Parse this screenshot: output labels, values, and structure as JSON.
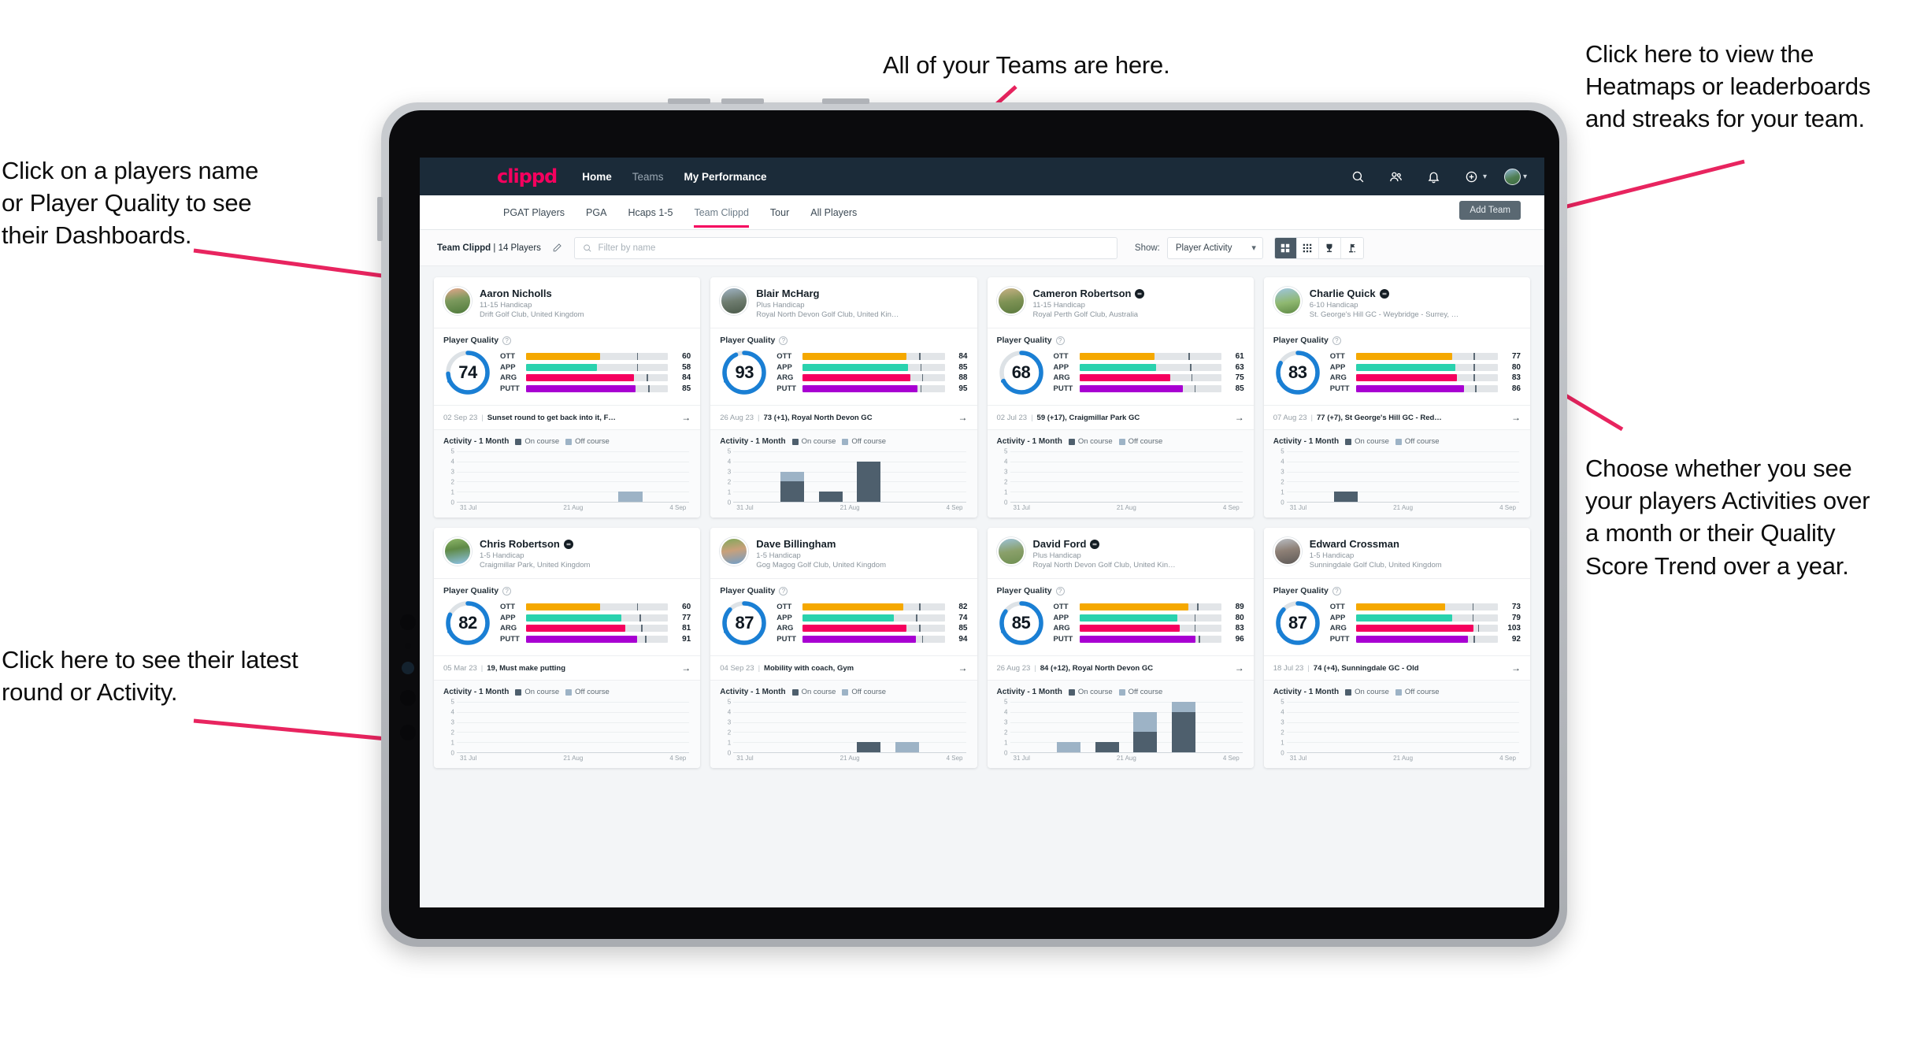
{
  "annotations": [
    {
      "id": "a-players-name",
      "text": "Click on a players name\nor Player Quality to see\ntheir Dashboards."
    },
    {
      "id": "a-teams",
      "text": "All of your Teams are here."
    },
    {
      "id": "a-heatmaps",
      "text": "Click here to view the\nHeatmaps or leaderboards\nand streaks for your team."
    },
    {
      "id": "a-choose",
      "text": "Choose whether you see\nyour players Activities over\na month or their Quality\nScore Trend over a year."
    },
    {
      "id": "a-latest-round",
      "text": "Click here to see their latest\nround or Activity."
    }
  ],
  "colors": {
    "accent": "#f5005e",
    "navbar": "#1b2b39",
    "ring": "#1a7fd4",
    "ott": "#f5a800",
    "app": "#2ad2ae",
    "arg": "#f5005e",
    "putt": "#a800d2",
    "on_course": "#4e5f6d",
    "off_course": "#9db3c6"
  },
  "navbar": {
    "brand": "clippd",
    "links": [
      {
        "label": "Home",
        "active": true
      },
      {
        "label": "Teams",
        "active": false
      },
      {
        "label": "My Performance",
        "active": true
      }
    ],
    "icons": [
      "search-icon",
      "people-icon",
      "bell-icon",
      "plus-circle-icon"
    ],
    "avatar_caret": "⌄"
  },
  "subtabs": {
    "items": [
      {
        "label": "PGAT Players",
        "active": false
      },
      {
        "label": "PGA",
        "active": false
      },
      {
        "label": "Hcaps 1-5",
        "active": false
      },
      {
        "label": "Team Clippd",
        "active": true
      },
      {
        "label": "Tour",
        "active": false
      },
      {
        "label": "All Players",
        "active": false
      }
    ],
    "add_team_label": "Add Team"
  },
  "toolbar": {
    "team_name": "Team Clippd",
    "separator": "|",
    "player_count": "14 Players",
    "edit_icon": "pencil-icon",
    "search_placeholder": "Filter by name",
    "search_value": "",
    "show_label": "Show:",
    "show_selected": "Player Activity",
    "show_options": [
      "Player Activity",
      "Quality Score Trend"
    ],
    "view_buttons": [
      {
        "name": "grid-view-icon",
        "active": true
      },
      {
        "name": "dots-grid-view-icon",
        "active": false
      },
      {
        "name": "trophy-view-icon",
        "active": false
      },
      {
        "name": "flag-view-icon",
        "active": false
      }
    ]
  },
  "quality_section": {
    "title": "Player Quality",
    "info_icon": "question-circle-icon",
    "metric_labels": [
      "OTT",
      "APP",
      "ARG",
      "PUTT"
    ]
  },
  "activity_section": {
    "title": "Activity - 1 Month",
    "legend_on": "On course",
    "legend_off": "Off course",
    "y_ticks": [
      "5",
      "4",
      "3",
      "2",
      "1",
      "0"
    ],
    "x_ticks": [
      "31 Jul",
      "21 Aug",
      "4 Sep"
    ]
  },
  "players": [
    {
      "name": "Aaron Nicholls",
      "verified": false,
      "handicap": "11-15 Handicap",
      "club": "Drift Golf Club, United Kingdom",
      "avatar_gradient": "linear-gradient(170deg,#e6a68c 0%,#7d9a5e 45%,#4f7a3b 100%)",
      "quality_score": 74,
      "metrics": [
        {
          "key": "OTT",
          "value": 60,
          "fill_pct": 52,
          "tick_pct": 78
        },
        {
          "key": "APP",
          "value": 58,
          "fill_pct": 50,
          "tick_pct": 78
        },
        {
          "key": "ARG",
          "value": 84,
          "fill_pct": 76,
          "tick_pct": 85
        },
        {
          "key": "PUTT",
          "value": 85,
          "fill_pct": 77,
          "tick_pct": 86
        }
      ],
      "round_date": "02 Sep 23",
      "round_text": "Sunset round to get back into it, F…",
      "activity": [
        {
          "on": 0,
          "off": 0
        },
        {
          "on": 0,
          "off": 0
        },
        {
          "on": 0,
          "off": 0
        },
        {
          "on": 0,
          "off": 0
        },
        {
          "on": 0,
          "off": 1
        },
        {
          "on": 0,
          "off": 0
        }
      ]
    },
    {
      "name": "Blair McHarg",
      "verified": false,
      "handicap": "Plus Handicap",
      "club": "Royal North Devon Golf Club, United Kin…",
      "avatar_gradient": "linear-gradient(170deg,#9fb3c4 0%,#6f7d70 50%,#4b5a4a 100%)",
      "quality_score": 93,
      "metrics": [
        {
          "key": "OTT",
          "value": 84,
          "fill_pct": 73,
          "tick_pct": 82
        },
        {
          "key": "APP",
          "value": 85,
          "fill_pct": 74,
          "tick_pct": 83
        },
        {
          "key": "ARG",
          "value": 88,
          "fill_pct": 76,
          "tick_pct": 84
        },
        {
          "key": "PUTT",
          "value": 95,
          "fill_pct": 81,
          "tick_pct": 83
        }
      ],
      "round_date": "26 Aug 23",
      "round_text": "73 (+1), Royal North Devon GC",
      "activity": [
        {
          "on": 0,
          "off": 0
        },
        {
          "on": 2,
          "off": 1
        },
        {
          "on": 1,
          "off": 0
        },
        {
          "on": 4,
          "off": 0
        },
        {
          "on": 0,
          "off": 0
        },
        {
          "on": 0,
          "off": 0
        }
      ]
    },
    {
      "name": "Cameron Robertson",
      "verified": true,
      "handicap": "11-15 Handicap",
      "club": "Royal Perth Golf Club, Australia",
      "avatar_gradient": "linear-gradient(170deg,#c8b184 0%,#7f9355 50%,#5b7a3e 100%)",
      "quality_score": 68,
      "metrics": [
        {
          "key": "OTT",
          "value": 61,
          "fill_pct": 53,
          "tick_pct": 77
        },
        {
          "key": "APP",
          "value": 63,
          "fill_pct": 54,
          "tick_pct": 78
        },
        {
          "key": "ARG",
          "value": 75,
          "fill_pct": 64,
          "tick_pct": 79
        },
        {
          "key": "PUTT",
          "value": 85,
          "fill_pct": 73,
          "tick_pct": 81
        }
      ],
      "round_date": "02 Jul 23",
      "round_text": "59 (+17), Craigmillar Park GC",
      "activity": [
        {
          "on": 0,
          "off": 0
        },
        {
          "on": 0,
          "off": 0
        },
        {
          "on": 0,
          "off": 0
        },
        {
          "on": 0,
          "off": 0
        },
        {
          "on": 0,
          "off": 0
        },
        {
          "on": 0,
          "off": 0
        }
      ]
    },
    {
      "name": "Charlie Quick",
      "verified": true,
      "handicap": "6-10 Handicap",
      "club": "St. George's Hill GC - Weybridge - Surrey, …",
      "avatar_gradient": "linear-gradient(170deg,#9fc6e0 0%,#8fb870 55%,#5f8a46 100%)",
      "quality_score": 83,
      "metrics": [
        {
          "key": "OTT",
          "value": 77,
          "fill_pct": 68,
          "tick_pct": 83
        },
        {
          "key": "APP",
          "value": 80,
          "fill_pct": 70,
          "tick_pct": 83
        },
        {
          "key": "ARG",
          "value": 83,
          "fill_pct": 71,
          "tick_pct": 83
        },
        {
          "key": "PUTT",
          "value": 86,
          "fill_pct": 76,
          "tick_pct": 84
        }
      ],
      "round_date": "07 Aug 23",
      "round_text": "77 (+7), St George's Hill GC - Red…",
      "activity": [
        {
          "on": 0,
          "off": 0
        },
        {
          "on": 1,
          "off": 0
        },
        {
          "on": 0,
          "off": 0
        },
        {
          "on": 0,
          "off": 0
        },
        {
          "on": 0,
          "off": 0
        },
        {
          "on": 0,
          "off": 0
        }
      ]
    },
    {
      "name": "Chris Robertson",
      "verified": true,
      "handicap": "1-5 Handicap",
      "club": "Craigmillar Park, United Kingdom",
      "avatar_gradient": "linear-gradient(170deg,#8fb86a 0%,#5f8a46 40%,#8ec3e8 100%)",
      "quality_score": 82,
      "metrics": [
        {
          "key": "OTT",
          "value": 60,
          "fill_pct": 52,
          "tick_pct": 78
        },
        {
          "key": "APP",
          "value": 77,
          "fill_pct": 67,
          "tick_pct": 80
        },
        {
          "key": "ARG",
          "value": 81,
          "fill_pct": 70,
          "tick_pct": 81
        },
        {
          "key": "PUTT",
          "value": 91,
          "fill_pct": 78,
          "tick_pct": 84
        }
      ],
      "round_date": "05 Mar 23",
      "round_text": "19, Must make putting",
      "activity": [
        {
          "on": 0,
          "off": 0
        },
        {
          "on": 0,
          "off": 0
        },
        {
          "on": 0,
          "off": 0
        },
        {
          "on": 0,
          "off": 0
        },
        {
          "on": 0,
          "off": 0
        },
        {
          "on": 0,
          "off": 0
        }
      ]
    },
    {
      "name": "Dave Billingham",
      "verified": false,
      "handicap": "1-5 Handicap",
      "club": "Gog Magog Golf Club, United Kingdom",
      "avatar_gradient": "linear-gradient(170deg,#7fa85a 0%,#c9a07a 45%,#6f9ec9 100%)",
      "quality_score": 87,
      "metrics": [
        {
          "key": "OTT",
          "value": 82,
          "fill_pct": 71,
          "tick_pct": 82
        },
        {
          "key": "APP",
          "value": 74,
          "fill_pct": 64,
          "tick_pct": 80
        },
        {
          "key": "ARG",
          "value": 85,
          "fill_pct": 73,
          "tick_pct": 82
        },
        {
          "key": "PUTT",
          "value": 94,
          "fill_pct": 80,
          "tick_pct": 84
        }
      ],
      "round_date": "04 Sep 23",
      "round_text": "Mobility with coach, Gym",
      "activity": [
        {
          "on": 0,
          "off": 0
        },
        {
          "on": 0,
          "off": 0
        },
        {
          "on": 0,
          "off": 0
        },
        {
          "on": 1,
          "off": 0
        },
        {
          "on": 0,
          "off": 1
        },
        {
          "on": 0,
          "off": 0
        }
      ]
    },
    {
      "name": "David Ford",
      "verified": true,
      "handicap": "Plus Handicap",
      "club": "Royal North Devon Golf Club, United Kin…",
      "avatar_gradient": "linear-gradient(170deg,#9cc2d8 0%,#8aa06a 50%,#6f8f52 100%)",
      "quality_score": 85,
      "metrics": [
        {
          "key": "OTT",
          "value": 89,
          "fill_pct": 77,
          "tick_pct": 83
        },
        {
          "key": "APP",
          "value": 80,
          "fill_pct": 69,
          "tick_pct": 81
        },
        {
          "key": "ARG",
          "value": 83,
          "fill_pct": 71,
          "tick_pct": 81
        },
        {
          "key": "PUTT",
          "value": 96,
          "fill_pct": 82,
          "tick_pct": 84
        }
      ],
      "round_date": "26 Aug 23",
      "round_text": "84 (+12), Royal North Devon GC",
      "activity": [
        {
          "on": 0,
          "off": 0
        },
        {
          "on": 0,
          "off": 1
        },
        {
          "on": 1,
          "off": 0
        },
        {
          "on": 2,
          "off": 2
        },
        {
          "on": 4,
          "off": 1
        },
        {
          "on": 0,
          "off": 0
        }
      ]
    },
    {
      "name": "Edward Crossman",
      "verified": false,
      "handicap": "1-5 Handicap",
      "club": "Sunningdale Golf Club, United Kingdom",
      "avatar_gradient": "linear-gradient(170deg,#b9bec4 0%,#8e8076 45%,#5e5a58 100%)",
      "quality_score": 87,
      "metrics": [
        {
          "key": "OTT",
          "value": 73,
          "fill_pct": 63,
          "tick_pct": 82
        },
        {
          "key": "APP",
          "value": 79,
          "fill_pct": 68,
          "tick_pct": 82
        },
        {
          "key": "ARG",
          "value": 103,
          "fill_pct": 83,
          "tick_pct": 86
        },
        {
          "key": "PUTT",
          "value": 92,
          "fill_pct": 79,
          "tick_pct": 83
        }
      ],
      "round_date": "18 Jul 23",
      "round_text": "74 (+4), Sunningdale GC - Old",
      "activity": [
        {
          "on": 0,
          "off": 0
        },
        {
          "on": 0,
          "off": 0
        },
        {
          "on": 0,
          "off": 0
        },
        {
          "on": 0,
          "off": 0
        },
        {
          "on": 0,
          "off": 0
        },
        {
          "on": 0,
          "off": 0
        }
      ]
    }
  ]
}
